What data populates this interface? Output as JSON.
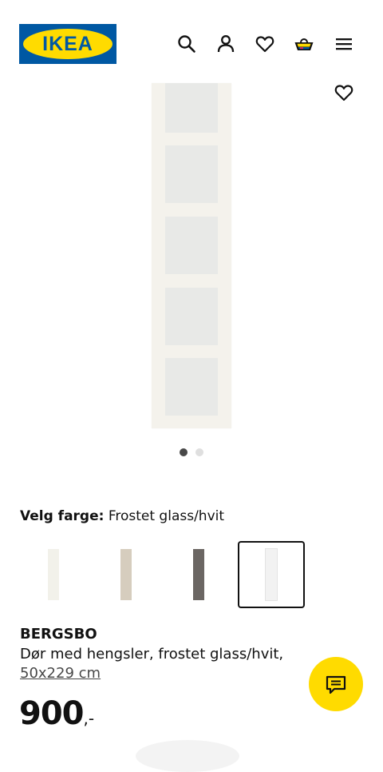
{
  "header": {
    "logo_text": "IKEA",
    "icons": [
      "search-icon",
      "user-icon",
      "heart-icon",
      "basket-icon",
      "menu-icon"
    ]
  },
  "product": {
    "image_count": 2,
    "active_image": 1,
    "color_label": "Velg farge:",
    "color_value": "Frostet glass/hvit",
    "swatches": [
      {
        "color": "#f2f1ea"
      },
      {
        "color": "#d6cdbe"
      },
      {
        "color": "#6b6663"
      },
      {
        "color": "#f2f2f2",
        "selected": true
      }
    ],
    "name": "BERGSBO",
    "description": "Dør med hengsler, frostet glass/hvit,",
    "size": "50x229 cm",
    "price": "900",
    "price_suffix": ",-"
  },
  "colors": {
    "ikea_blue": "#0058a3",
    "ikea_yellow": "#ffdb00"
  }
}
